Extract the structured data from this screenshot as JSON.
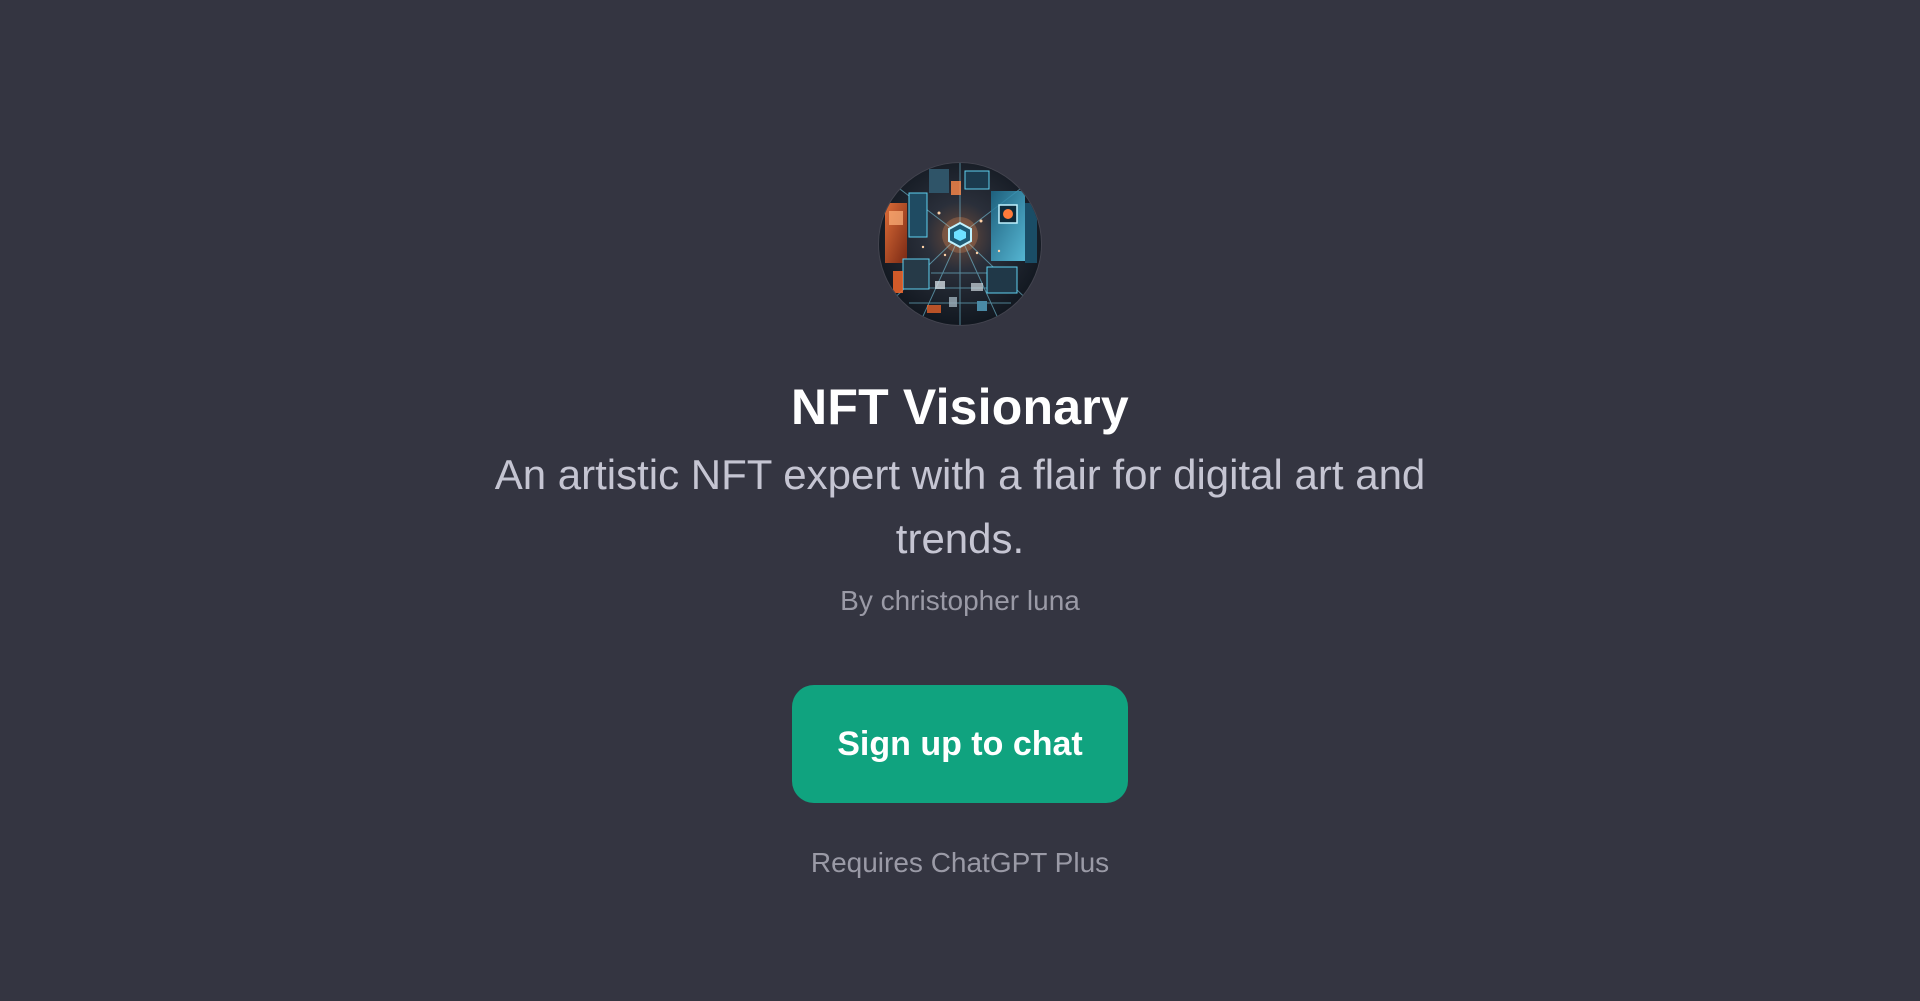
{
  "gpt": {
    "avatar_icon": "nft-artwork-avatar-icon",
    "title": "NFT Visionary",
    "description": "An artistic NFT expert with a flair for digital art and trends.",
    "author": "By christopher luna"
  },
  "actions": {
    "signup_label": "Sign up to chat",
    "requirement": "Requires ChatGPT Plus"
  },
  "colors": {
    "background": "#343541",
    "title": "#ffffff",
    "description": "#c5c5d2",
    "muted": "#9a9aa6",
    "button": "#10a37f",
    "button_text": "#ffffff"
  }
}
